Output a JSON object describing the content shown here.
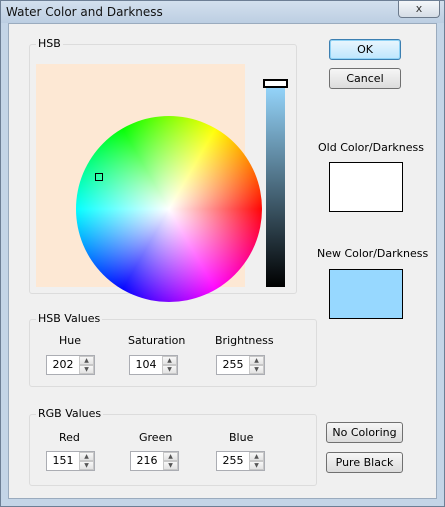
{
  "window": {
    "title": "Water Color and Darkness",
    "close_label": "x"
  },
  "hsb_group": {
    "label": "HSB"
  },
  "buttons": {
    "ok": "OK",
    "cancel": "Cancel",
    "no_coloring": "No Coloring",
    "pure_black": "Pure Black"
  },
  "old_color": {
    "label": "Old Color/Darkness",
    "color": "#ffffff"
  },
  "new_color": {
    "label": "New Color/Darkness",
    "color": "#97d8ff"
  },
  "hsb_values": {
    "label": "HSB Values",
    "hue": {
      "label": "Hue",
      "value": "202"
    },
    "saturation": {
      "label": "Saturation",
      "value": "104"
    },
    "brightness": {
      "label": "Brightness",
      "value": "255"
    }
  },
  "rgb_values": {
    "label": "RGB Values",
    "red": {
      "label": "Red",
      "value": "151"
    },
    "green": {
      "label": "Green",
      "value": "216"
    },
    "blue": {
      "label": "Blue",
      "value": "255"
    }
  },
  "icons": {
    "spin_up": "▲",
    "spin_down": "▼"
  }
}
